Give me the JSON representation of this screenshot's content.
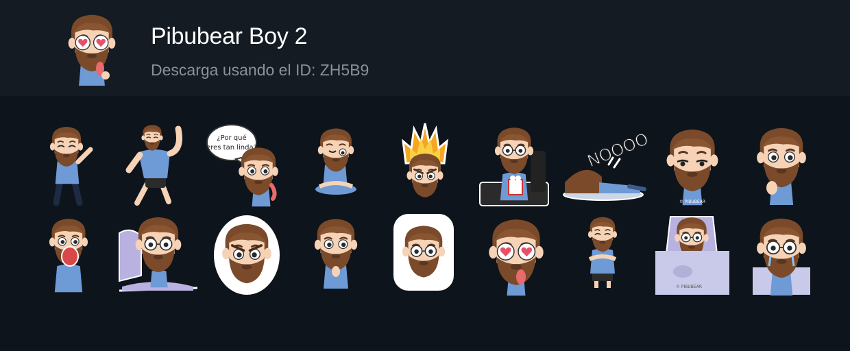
{
  "pack": {
    "title": "Pibubear Boy 2",
    "subtitle": "Descarga usando el ID: ZH5B9"
  },
  "stickers": {
    "bubble_text_line1": "¿Por qué",
    "bubble_text_line2": "eres tan linda?",
    "nooo_text": "NOOOO",
    "watermark": "© PIBUBEAR"
  },
  "colors": {
    "background": "#0d141b",
    "header_background": "#141b23",
    "hair": "#7a4a2a",
    "skin": "#f6d3b6",
    "shirt": "#6e9ad6"
  }
}
